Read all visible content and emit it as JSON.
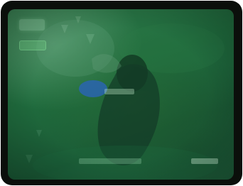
{
  "game": {
    "view": "night-vision",
    "accent": "#2f7a4a",
    "frame": "#0b0f0b"
  },
  "hud": {
    "top_left": "",
    "status": "",
    "target_label": "",
    "bottom_center": "",
    "bottom_right": ""
  }
}
